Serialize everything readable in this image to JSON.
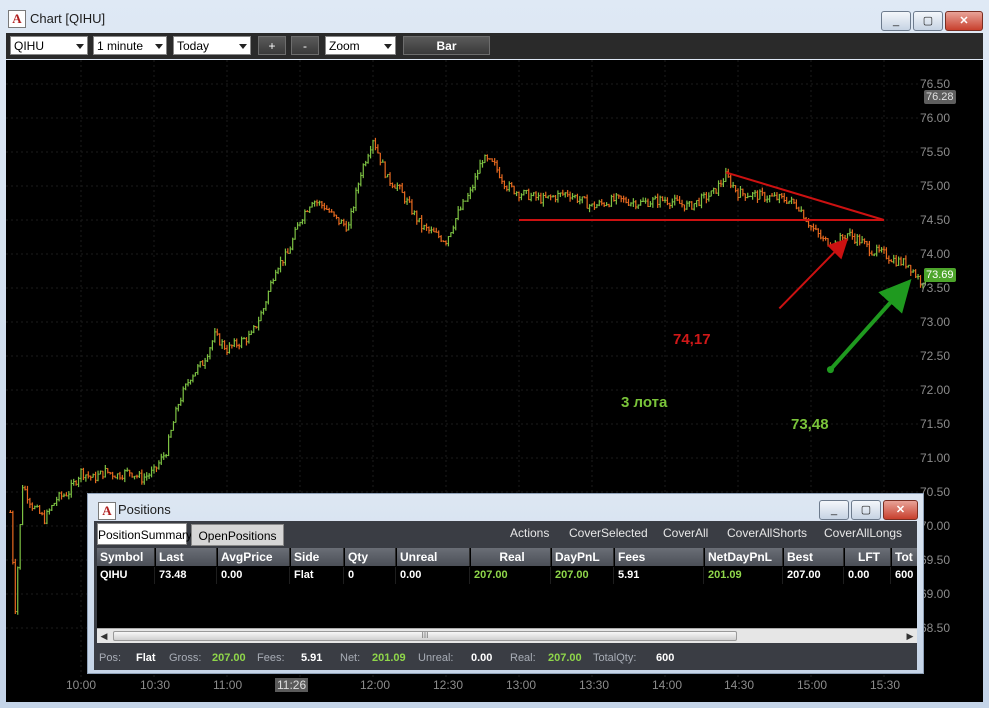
{
  "window": {
    "title": "Chart [QIHU]",
    "app_icon_glyph": "A",
    "buttons": [
      "_",
      "▢",
      "✕"
    ]
  },
  "toolbar": {
    "symbol": "QIHU",
    "interval": "1 minute",
    "range": "Today",
    "zoom_in": "+",
    "zoom_out": "-",
    "zoom": "Zoom",
    "chart_type": "Bar"
  },
  "chart": {
    "price_labels": [
      "76.50",
      "76.00",
      "75.50",
      "75.00",
      "74.50",
      "74.00",
      "73.50",
      "73.00",
      "72.50",
      "72.00",
      "71.50",
      "71.00",
      "70.50",
      "70.00",
      "69.50",
      "69.00",
      "68.50"
    ],
    "time_labels": [
      "10:00",
      "10:30",
      "11:00",
      "11:26",
      "12:00",
      "12:30",
      "13:00",
      "13:30",
      "14:00",
      "14:30",
      "15:00",
      "15:30"
    ],
    "high_tag": "76.28",
    "last_tag": "73.69",
    "annotations": {
      "red_price": "74,17",
      "lots": "3 лота",
      "green_price": "73,48"
    },
    "colors": {
      "up": "#7dc243",
      "down": "#e8691f",
      "background": "#000000",
      "red_line": "#cc1111",
      "green_arrow": "#1f9a1f"
    }
  },
  "chart_data": {
    "type": "bar",
    "title": "",
    "xlabel": "",
    "ylabel": "",
    "ylim": [
      68.3,
      76.7
    ],
    "x_range": [
      "09:30",
      "16:00"
    ],
    "series": [
      {
        "x": [
          "09:31",
          "09:33",
          "09:36",
          "09:40",
          "09:45",
          "09:50",
          "09:55",
          "10:00",
          "10:05",
          "10:10",
          "10:15",
          "10:20",
          "10:25",
          "10:30",
          "10:35",
          "10:40",
          "10:45",
          "10:50",
          "10:55",
          "11:00",
          "11:05",
          "11:10",
          "11:15",
          "11:20",
          "11:25",
          "11:30",
          "11:35",
          "11:40",
          "11:45",
          "11:50",
          "11:55",
          "12:00",
          "12:03",
          "12:06",
          "12:10",
          "12:15",
          "12:20",
          "12:25",
          "12:30",
          "12:35",
          "12:40",
          "12:45",
          "12:50",
          "12:55",
          "13:00",
          "13:10",
          "13:20",
          "13:30",
          "13:40",
          "13:50",
          "14:00",
          "14:10",
          "14:20",
          "14:25",
          "14:30",
          "14:40",
          "14:50",
          "14:55",
          "15:00",
          "15:05",
          "15:10",
          "15:15",
          "15:20",
          "15:25",
          "15:30",
          "15:35",
          "15:40",
          "15:45",
          "15:48"
        ],
        "y": [
          70.2,
          68.8,
          70.6,
          70.3,
          70.1,
          70.4,
          70.5,
          70.8,
          70.7,
          70.8,
          70.75,
          70.8,
          70.7,
          70.8,
          71.1,
          71.8,
          72.2,
          72.4,
          72.8,
          72.6,
          72.7,
          72.8,
          73.2,
          73.8,
          74.0,
          74.5,
          74.8,
          74.7,
          74.5,
          74.4,
          75.2,
          75.7,
          75.4,
          75.1,
          75.0,
          74.7,
          74.4,
          74.3,
          74.2,
          74.6,
          74.9,
          75.4,
          75.3,
          75.0,
          74.9,
          74.8,
          74.9,
          74.7,
          74.8,
          74.75,
          74.8,
          74.7,
          74.9,
          75.15,
          74.9,
          74.85,
          74.8,
          74.7,
          74.4,
          74.2,
          74.15,
          74.3,
          74.2,
          74.05,
          74.0,
          73.9,
          73.85,
          73.6,
          73.69
        ]
      }
    ],
    "annotations": [
      {
        "type": "support",
        "y": 74.5,
        "x": [
          "13:00",
          "15:30"
        ]
      },
      {
        "type": "trendline",
        "from": {
          "x": "14:25",
          "y": 75.2
        },
        "to": {
          "x": "15:30",
          "y": 74.5
        }
      },
      {
        "type": "arrow",
        "color": "red",
        "from": {
          "x": "14:47",
          "y": 73.2
        },
        "to": {
          "x": "15:13",
          "y": 74.15
        }
      },
      {
        "type": "arrow",
        "color": "green",
        "from": {
          "x": "15:08",
          "y": 72.3
        },
        "to": {
          "x": "15:38",
          "y": 73.5
        }
      }
    ]
  },
  "positions": {
    "title": "Positions",
    "tabs": [
      "PositionSummary",
      "OpenPositions"
    ],
    "actions": [
      "Actions",
      "CoverSelected",
      "CoverAll",
      "CoverAllShorts",
      "CoverAllLongs"
    ],
    "columns": [
      "Symbol",
      "Last",
      "AvgPrice",
      "Side",
      "Qty",
      "Unreal",
      "Real",
      "DayPnL",
      "Fees",
      "NetDayPnL",
      "Best",
      "LFT",
      "Tot"
    ],
    "row": [
      "QIHU",
      "73.48",
      "0.00",
      "Flat",
      "0",
      "0.00",
      "207.00",
      "207.00",
      "5.91",
      "201.09",
      "207.00",
      "0.00",
      "600"
    ],
    "green_columns": [
      6,
      7,
      9
    ],
    "scroll_thumb": "III",
    "status": {
      "pos_label": "Pos:",
      "pos": "Flat",
      "gross_label": "Gross:",
      "gross": "207.00",
      "fees_label": "Fees:",
      "fees": "5.91",
      "net_label": "Net:",
      "net": "201.09",
      "unreal_label": "Unreal:",
      "unreal": "0.00",
      "real_label": "Real:",
      "real": "207.00",
      "totalqty_label": "TotalQty:",
      "totalqty": "600"
    }
  }
}
